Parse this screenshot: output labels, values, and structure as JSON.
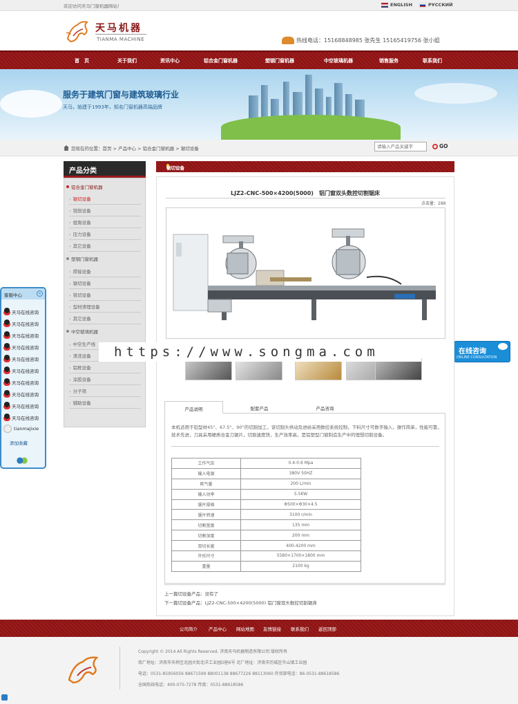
{
  "topbar": {
    "welcome": "欢迎访问天马门窗机器网站！",
    "lang_en": "ENGLISH",
    "lang_ru": "РУССКИЙ"
  },
  "header": {
    "logo_cn": "天马机器",
    "logo_en": "TIANMA MACHINE",
    "hotline": "热线电话：15168848985 张先生   15165419756 张小姐"
  },
  "nav": [
    "首　页",
    "关于我们",
    "资讯中心",
    "铝合金门窗机器",
    "塑钢门窗机器",
    "中空玻璃机器",
    "销售服务",
    "联系我们"
  ],
  "banner": {
    "title": "服务于建筑门窗与建筑玻璃行业",
    "subtitle": "天马，始建于1993年，知名门窗机器高端品牌"
  },
  "breadcrumb": "您现在的位置：首页 > 产品中心 > 铝合金门窗机器 > 锯切设备",
  "search": {
    "placeholder": "请输入产品关键字",
    "go": "GO"
  },
  "sidebar": {
    "title": "产品分类",
    "cat1": "铝合金门窗机器",
    "cat1_items": [
      "锯切设备",
      "铣削设备",
      "组角设备",
      "压力设备",
      "其它设备"
    ],
    "cat2": "塑钢门窗机器",
    "cat2_items": [
      "焊接设备",
      "锯切设备",
      "铣切设备",
      "型材清理设备",
      "其它设备"
    ],
    "cat3": "中空玻璃机器",
    "cat3_items": [
      "中空生产线",
      "清洗设备",
      "铝框设备",
      "涂胶设备",
      "分子筛",
      "辅助设备"
    ]
  },
  "service_panel": {
    "title": "客服中心",
    "items": [
      "天马在线咨询",
      "天马在线咨询",
      "天马在线咨询",
      "天马在线咨询",
      "天马在线咨询",
      "天马在线咨询",
      "天马在线咨询",
      "天马在线咨询",
      "天马在线咨询",
      "天马在线咨询",
      "天马在线咨询"
    ],
    "wechat": "tianmajixie",
    "fav": "添加收藏"
  },
  "online_float": {
    "title": "在线咨询",
    "subtitle": "ONLINE CONSULTATION"
  },
  "section_title": "锯切设备",
  "product": {
    "title": "LJZ2-CNC-500×4200(5000)　铝门窗双头数控切割锯床",
    "clicks": "点击量：288",
    "watermark": "https://www.songma.com"
  },
  "tabs": [
    "产品说明",
    "配套产品",
    "产品咨询"
  ],
  "description": "本机适用于铝型材45°、67.5°、90°的切割加工，该切割头供动及进给采用数控系统控制，下料尺寸可数字输入，操作简单，性能可靠，技术先进，刀具采用硬质合金刀锯片，切割速度快，生产效率高，是铝塑型门窗制造生产中的理想切割设备。",
  "specs": [
    [
      "工作气压",
      "0.4-0.6 Mpa"
    ],
    [
      "输入电源",
      "380V 50HZ"
    ],
    [
      "耗气量",
      "200 L/min"
    ],
    [
      "输入功率",
      "5.5KW"
    ],
    [
      "锯片规格",
      "Φ500×Φ30×4.5"
    ],
    [
      "锯片转速",
      "3100 r/min"
    ],
    [
      "切割宽度",
      "135 mm"
    ],
    [
      "切割深度",
      "200 mm"
    ],
    [
      "双切长度",
      "400-4200 mm"
    ],
    [
      "外形尺寸",
      "5580×1700×1800 mm"
    ],
    [
      "重量",
      "2100 kg"
    ]
  ],
  "prev": "上一篇切设备产品：没有了",
  "next": "下一篇切设备产品：LJZ2-CNC-500×4200(5000) 铝门窗双头数控切割锯床",
  "footer": {
    "links": [
      "公司简介",
      "产品中心",
      "网站地图",
      "友情链接",
      "联系我们",
      "返回顶部"
    ],
    "copyright": "Copyright © 2014   All Rights Reserved.   济南天马机器制造有限公司   版权所有",
    "address": "南厂地址：济南市天桥区北园大街北洋工业园D座6号   北厂地址：济南市历城区华山镇工业园",
    "phone": "电话：0531-85956056 88671599  88001138 88677226 88113060    外贸部电话：86-0531-88618586",
    "hotline": "全国热线电话：400-075-7278   传真：0531-88618586"
  }
}
